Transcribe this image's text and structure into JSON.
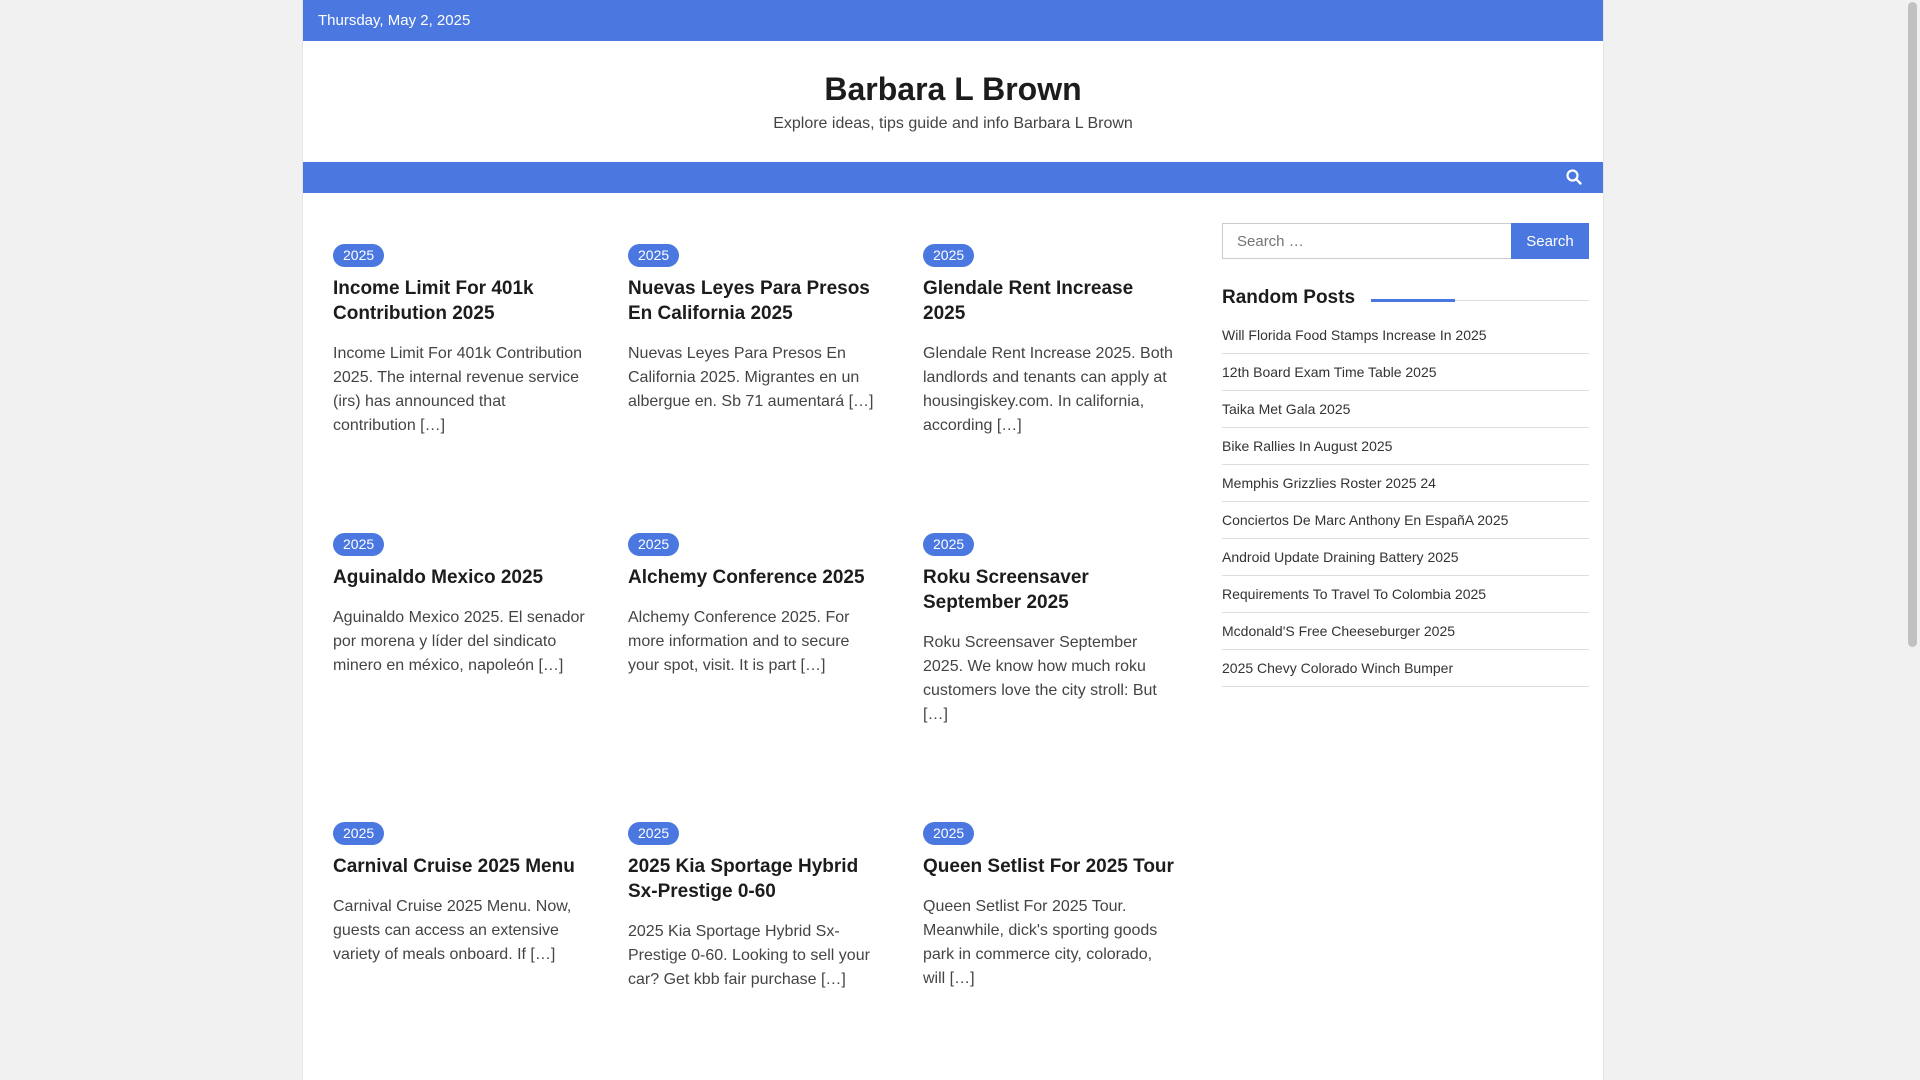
{
  "topbar": {
    "date": "Thursday, May 2, 2025"
  },
  "site": {
    "title": "Barbara L Brown",
    "description": "Explore ideas, tips guide and info Barbara L Brown"
  },
  "nav": {
    "search_icon": "search-icon"
  },
  "posts": [
    {
      "category": "2025",
      "title": "Income Limit For 401k Contribution 2025",
      "excerpt": "Income Limit For 401k Contribution 2025. The internal revenue service (irs) has announced that contribution […]"
    },
    {
      "category": "2025",
      "title": "Nuevas Leyes Para Presos En California 2025",
      "excerpt": "Nuevas Leyes Para Presos En California 2025. Migrantes en un albergue en. Sb 71 aumentará […]"
    },
    {
      "category": "2025",
      "title": "Glendale Rent Increase 2025",
      "excerpt": "Glendale Rent Increase 2025. Both landlords and tenants can apply at housingiskey.com. In california, according […]"
    },
    {
      "category": "2025",
      "title": "Aguinaldo Mexico 2025",
      "excerpt": "Aguinaldo Mexico 2025. El senador por morena y líder del sindicato minero en méxico, napoleón […]"
    },
    {
      "category": "2025",
      "title": "Alchemy Conference 2025",
      "excerpt": "Alchemy Conference 2025. For more information and to secure your spot, visit. It is part […]"
    },
    {
      "category": "2025",
      "title": "Roku Screensaver September 2025",
      "excerpt": "Roku Screensaver September 2025. We know how much roku customers love the city stroll: But […]"
    },
    {
      "category": "2025",
      "title": "Carnival Cruise 2025 Menu",
      "excerpt": "Carnival Cruise 2025 Menu. Now, guests can access an extensive variety of meals onboard. If […]"
    },
    {
      "category": "2025",
      "title": "2025 Kia Sportage Hybrid Sx-Prestige 0-60",
      "excerpt": "2025 Kia Sportage Hybrid Sx-Prestige 0-60. Looking to sell your car? Get kbb fair purchase […]"
    },
    {
      "category": "2025",
      "title": "Queen Setlist For 2025 Tour",
      "excerpt": "Queen Setlist For 2025 Tour. Meanwhile, dick's sporting goods park in commerce city, colorado, will […]"
    }
  ],
  "sidebar": {
    "search": {
      "placeholder": "Search …",
      "button": "Search"
    },
    "random_posts": {
      "title": "Random Posts",
      "items": [
        "Will Florida Food Stamps Increase In 2025",
        "12th Board Exam Time Table 2025",
        "Taika Met Gala 2025",
        "Bike Rallies In August 2025",
        "Memphis Grizzlies Roster 2025 24",
        "Conciertos De Marc Anthony En EspañA 2025",
        "Android Update Draining Battery 2025",
        "Requirements To Travel To Colombia 2025",
        "Mcdonald'S Free Cheeseburger 2025",
        "2025 Chevy Colorado Winch Bumper"
      ]
    }
  },
  "colors": {
    "accent": "#4a77e0"
  }
}
